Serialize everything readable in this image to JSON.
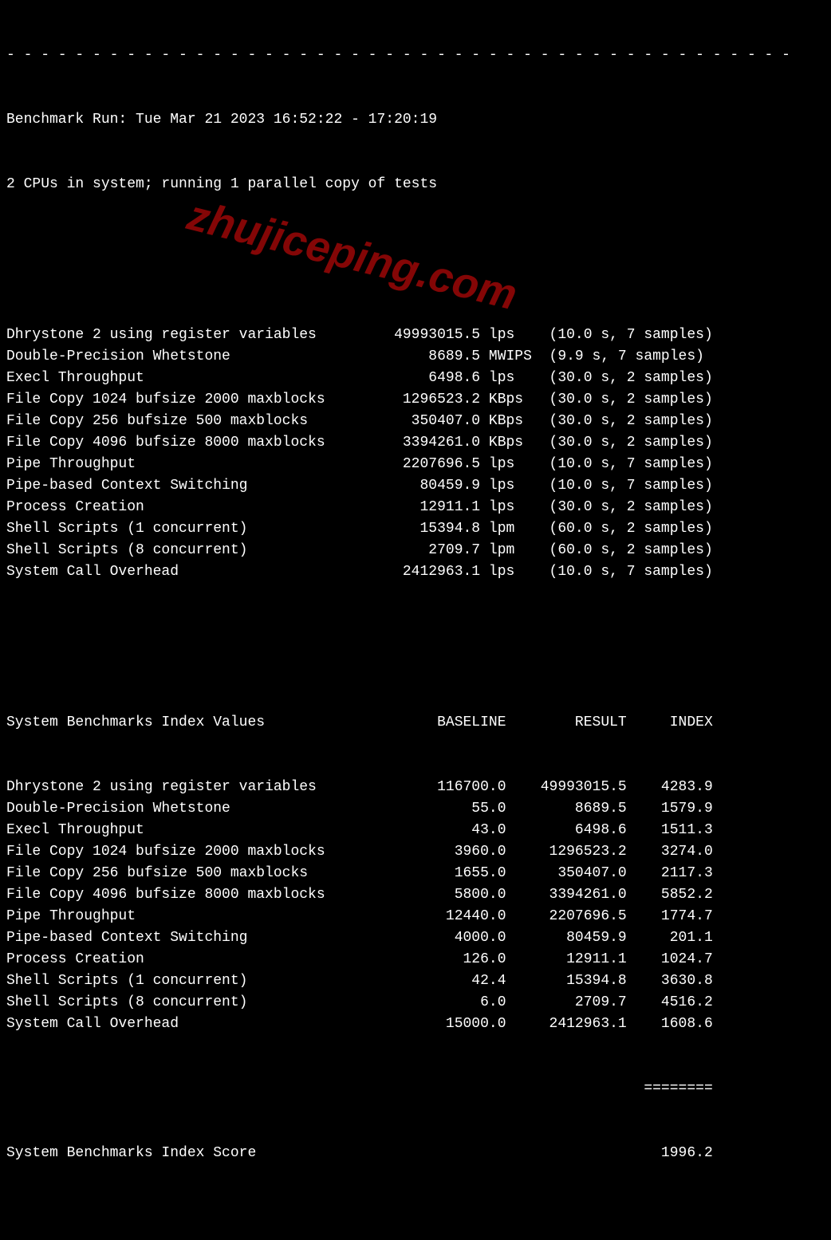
{
  "header": {
    "rule": "- - - - - - - - - - - - - - - - - - - - - - - - - - - - - - - - - - - - - - - - - - - - - - ",
    "run_line": "Benchmark Run: Tue Mar 21 2023 16:52:22 - 17:20:19",
    "cpu_line": "2 CPUs in system; running 1 parallel copy of tests"
  },
  "tests": [
    {
      "name": "Dhrystone 2 using register variables",
      "value": "49993015.5",
      "unit": "lps",
      "timing": "(10.0 s, 7 samples)"
    },
    {
      "name": "Double-Precision Whetstone",
      "value": "8689.5",
      "unit": "MWIPS",
      "timing": "(9.9 s, 7 samples)"
    },
    {
      "name": "Execl Throughput",
      "value": "6498.6",
      "unit": "lps",
      "timing": "(30.0 s, 2 samples)"
    },
    {
      "name": "File Copy 1024 bufsize 2000 maxblocks",
      "value": "1296523.2",
      "unit": "KBps",
      "timing": "(30.0 s, 2 samples)"
    },
    {
      "name": "File Copy 256 bufsize 500 maxblocks",
      "value": "350407.0",
      "unit": "KBps",
      "timing": "(30.0 s, 2 samples)"
    },
    {
      "name": "File Copy 4096 bufsize 8000 maxblocks",
      "value": "3394261.0",
      "unit": "KBps",
      "timing": "(30.0 s, 2 samples)"
    },
    {
      "name": "Pipe Throughput",
      "value": "2207696.5",
      "unit": "lps",
      "timing": "(10.0 s, 7 samples)"
    },
    {
      "name": "Pipe-based Context Switching",
      "value": "80459.9",
      "unit": "lps",
      "timing": "(10.0 s, 7 samples)"
    },
    {
      "name": "Process Creation",
      "value": "12911.1",
      "unit": "lps",
      "timing": "(30.0 s, 2 samples)"
    },
    {
      "name": "Shell Scripts (1 concurrent)",
      "value": "15394.8",
      "unit": "lpm",
      "timing": "(60.0 s, 2 samples)"
    },
    {
      "name": "Shell Scripts (8 concurrent)",
      "value": "2709.7",
      "unit": "lpm",
      "timing": "(60.0 s, 2 samples)"
    },
    {
      "name": "System Call Overhead",
      "value": "2412963.1",
      "unit": "lps",
      "timing": "(10.0 s, 7 samples)"
    }
  ],
  "index_header": {
    "title": "System Benchmarks Index Values",
    "col_baseline": "BASELINE",
    "col_result": "RESULT",
    "col_index": "INDEX"
  },
  "index_rows": [
    {
      "name": "Dhrystone 2 using register variables",
      "baseline": "116700.0",
      "result": "49993015.5",
      "index": "4283.9"
    },
    {
      "name": "Double-Precision Whetstone",
      "baseline": "55.0",
      "result": "8689.5",
      "index": "1579.9"
    },
    {
      "name": "Execl Throughput",
      "baseline": "43.0",
      "result": "6498.6",
      "index": "1511.3"
    },
    {
      "name": "File Copy 1024 bufsize 2000 maxblocks",
      "baseline": "3960.0",
      "result": "1296523.2",
      "index": "3274.0"
    },
    {
      "name": "File Copy 256 bufsize 500 maxblocks",
      "baseline": "1655.0",
      "result": "350407.0",
      "index": "2117.3"
    },
    {
      "name": "File Copy 4096 bufsize 8000 maxblocks",
      "baseline": "5800.0",
      "result": "3394261.0",
      "index": "5852.2"
    },
    {
      "name": "Pipe Throughput",
      "baseline": "12440.0",
      "result": "2207696.5",
      "index": "1774.7"
    },
    {
      "name": "Pipe-based Context Switching",
      "baseline": "4000.0",
      "result": "80459.9",
      "index": "201.1"
    },
    {
      "name": "Process Creation",
      "baseline": "126.0",
      "result": "12911.1",
      "index": "1024.7"
    },
    {
      "name": "Shell Scripts (1 concurrent)",
      "baseline": "42.4",
      "result": "15394.8",
      "index": "3630.8"
    },
    {
      "name": "Shell Scripts (8 concurrent)",
      "baseline": "6.0",
      "result": "2709.7",
      "index": "4516.2"
    },
    {
      "name": "System Call Overhead",
      "baseline": "15000.0",
      "result": "2412963.1",
      "index": "1608.6"
    }
  ],
  "index_rule": "========",
  "score": {
    "label": "System Benchmarks Index Score",
    "value": "1996.2"
  },
  "watermark": "zhujiceping.com"
}
